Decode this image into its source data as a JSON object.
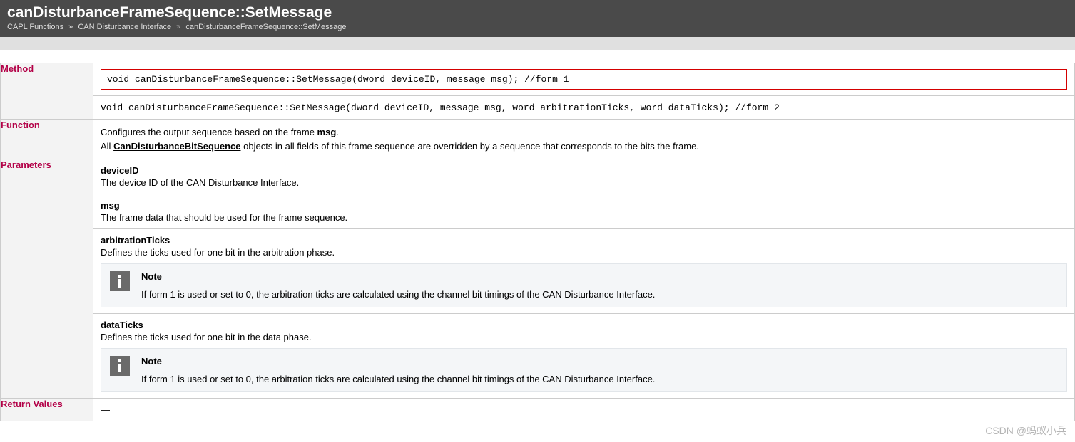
{
  "header": {
    "title": "canDisturbanceFrameSequence::SetMessage",
    "breadcrumb": {
      "part1": "CAPL Functions",
      "sep": "»",
      "part2": "CAN Disturbance Interface",
      "part3": "canDisturbanceFrameSequence::SetMessage"
    }
  },
  "rows": {
    "method": {
      "label": "Method",
      "sig1": "void canDisturbanceFrameSequence::SetMessage(dword deviceID, message msg); //form 1",
      "sig2": "void canDisturbanceFrameSequence::SetMessage(dword deviceID, message msg, word arbitrationTicks, word dataTicks); //form 2"
    },
    "function": {
      "label": "Function",
      "line1_pre": "Configures the output sequence based on the frame ",
      "line1_bold": "msg",
      "line1_post": ".",
      "line2_pre": "All ",
      "line2_link": "CanDisturbanceBitSequence",
      "line2_post": " objects in all fields of this frame sequence are overridden by a sequence that corresponds to the bits the frame."
    },
    "parameters": {
      "label": "Parameters",
      "items": [
        {
          "name": "deviceID",
          "desc": "The device ID of the CAN Disturbance Interface."
        },
        {
          "name": "msg",
          "desc": "The frame data that should be used for the frame sequence."
        },
        {
          "name": "arbitrationTicks",
          "desc": "Defines the ticks used for one bit in the arbitration phase.",
          "note": {
            "title": "Note",
            "body": "If form 1 is used or set to 0, the arbitration ticks are calculated using the channel bit timings of the CAN Disturbance Interface."
          }
        },
        {
          "name": "dataTicks",
          "desc": "Defines the ticks used for one bit in the data phase.",
          "note": {
            "title": "Note",
            "body": "If form 1 is used or set to 0, the arbitration ticks are calculated using the channel bit timings of the CAN Disturbance Interface."
          }
        }
      ]
    },
    "returnValues": {
      "label": "Return Values",
      "value": "—"
    }
  },
  "watermark": "CSDN @蚂蚁小兵"
}
